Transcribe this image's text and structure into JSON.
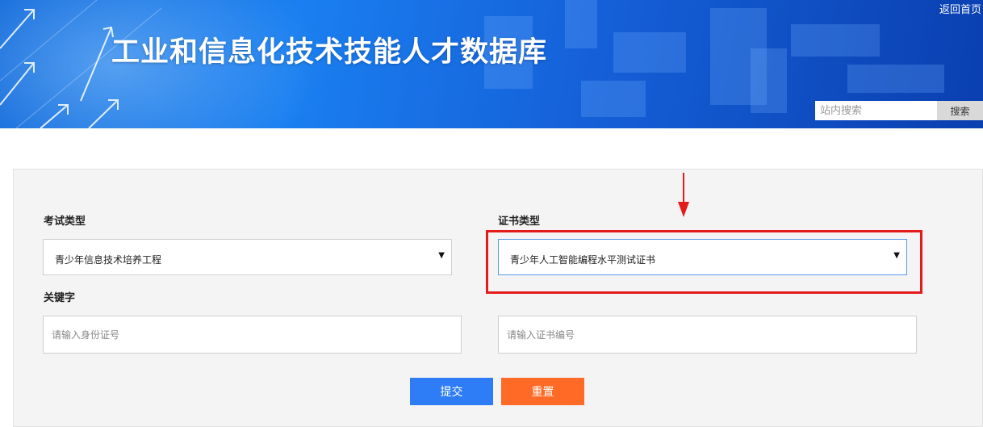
{
  "header": {
    "title": "工业和信息化技术技能人才数据库",
    "home_link": "返回首页",
    "search_placeholder": "站内搜索",
    "search_button": "搜索"
  },
  "form": {
    "exam_type": {
      "label": "考试类型",
      "value": "青少年信息技术培养工程"
    },
    "cert_type": {
      "label": "证书类型",
      "value": "青少年人工智能编程水平测试证书"
    },
    "keyword": {
      "label": "关键字",
      "id_placeholder": "请输入身份证号",
      "cert_no_placeholder": "请输入证书编号"
    },
    "submit_label": "提交",
    "reset_label": "重置"
  },
  "colors": {
    "banner_blue": "#1a7ff0",
    "submit_blue": "#2e7cf6",
    "reset_orange": "#ff6a26",
    "highlight_red": "#e41b1b"
  }
}
